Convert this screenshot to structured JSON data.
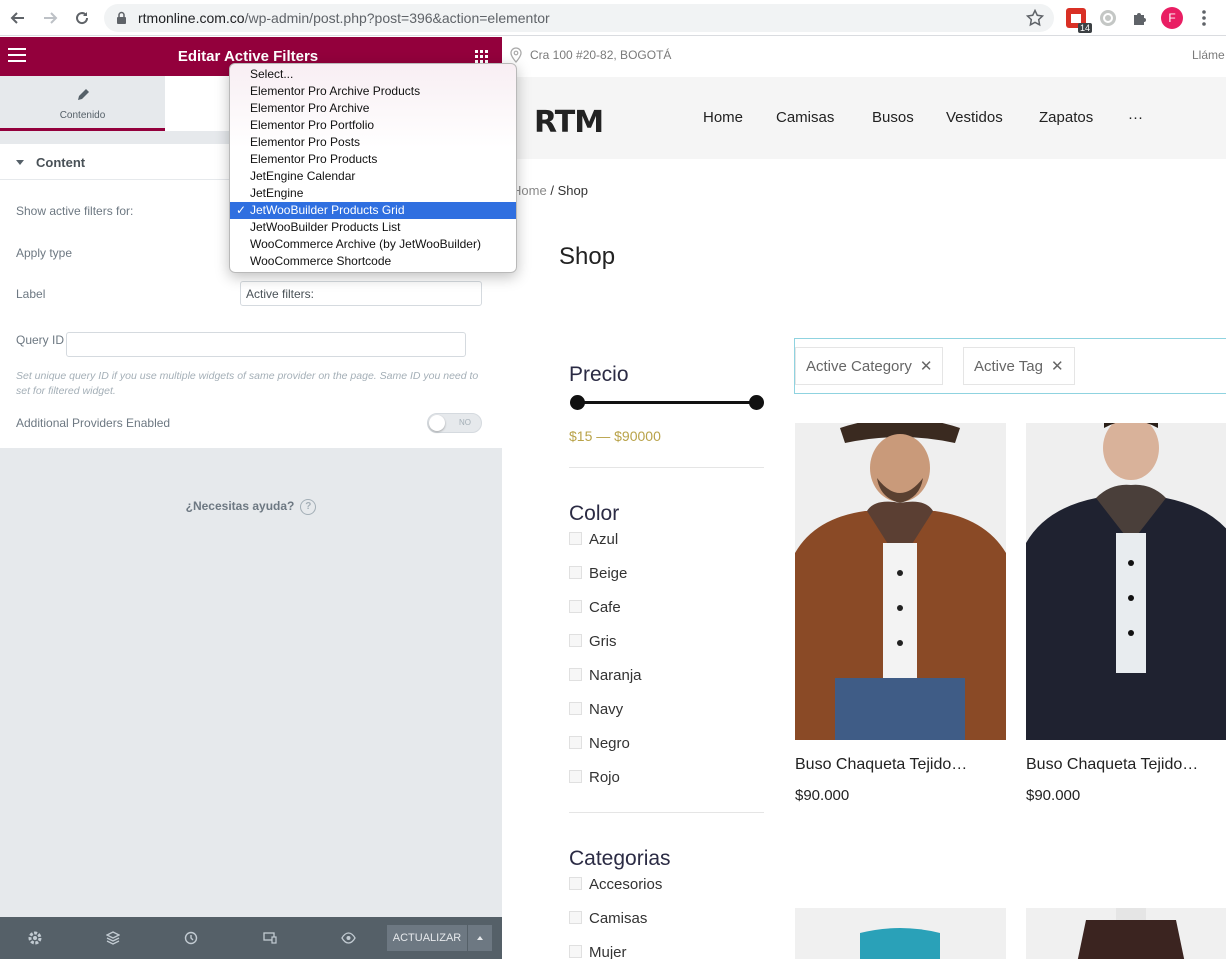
{
  "browser": {
    "url_host": "rtmonline.com.co",
    "url_path": "/wp-admin/post.php?post=396&action=elementor",
    "ext_badge": "14",
    "avatar_letter": "F"
  },
  "panel": {
    "title": "Editar Active Filters",
    "tab_content": "Contenido",
    "section_title": "Content",
    "show_for_label": "Show active filters for:",
    "apply_type_label": "Apply type",
    "label_label": "Label",
    "label_value": "Active filters:",
    "query_id_label": "Query ID",
    "query_id_value": "",
    "query_id_desc": "Set unique query ID if you use multiple widgets of same provider on the page. Same ID you need to set for filtered widget.",
    "additional_providers_label": "Additional Providers Enabled",
    "toggle_text": "NO",
    "help_text": "¿Necesitas ayuda?",
    "update_button": "ACTUALIZAR"
  },
  "dropdown": {
    "options": [
      "Select...",
      "Elementor Pro Archive Products",
      "Elementor Pro Archive",
      "Elementor Pro Portfolio",
      "Elementor Pro Posts",
      "Elementor Pro Products",
      "JetEngine Calendar",
      "JetEngine",
      "JetWooBuilder Products Grid",
      "JetWooBuilder Products List",
      "WooCommerce Archive (by JetWooBuilder)",
      "WooCommerce Shortcode"
    ],
    "selected_index": 8
  },
  "site": {
    "address": "Cra 100 #20-82, BOGOTÁ",
    "call_text": "Lláme",
    "logo": "RTM",
    "nav": [
      "Home",
      "Camisas",
      "Busos",
      "Vestidos",
      "Zapatos",
      "···"
    ],
    "breadcrumb_home": "Home",
    "breadcrumb_sep": "/",
    "breadcrumb_current": "Shop",
    "page_title": "Shop",
    "price_title": "Precio",
    "price_range": "$15 — $90000",
    "color_title": "Color",
    "colors": [
      "Azul",
      "Beige",
      "Cafe",
      "Gris",
      "Naranja",
      "Navy",
      "Negro",
      "Rojo"
    ],
    "categories_title": "Categorias",
    "categories": [
      "Accesorios",
      "Camisas",
      "Mujer"
    ],
    "active_chips": [
      "Active Category",
      "Active Tag"
    ],
    "products": [
      {
        "name": "Buso Chaqueta Tejido…",
        "price": "$90.000"
      },
      {
        "name": "Buso Chaqueta Tejido…",
        "price": "$90.000"
      }
    ]
  },
  "colors": {
    "elementor_brand": "#93003c",
    "selection_blue": "#2f6fe0",
    "price_gold": "#b9a34a",
    "active_border": "#8fd3e0"
  }
}
